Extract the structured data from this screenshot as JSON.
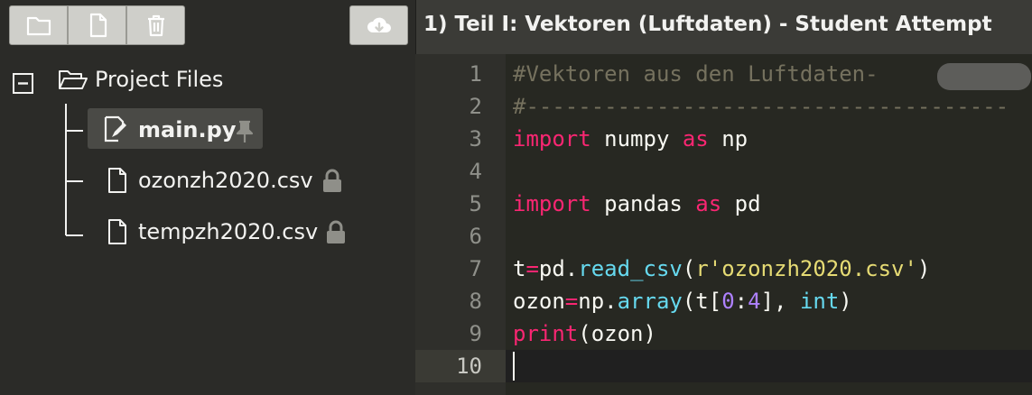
{
  "toolbar": {
    "new_folder_icon": "folder-icon",
    "new_file_icon": "file-icon",
    "delete_icon": "trash-icon",
    "download_icon": "cloud-download-icon"
  },
  "tree": {
    "root_label": "Project Files",
    "files": [
      {
        "name": "main.py",
        "badge": "pin-icon"
      },
      {
        "name": "ozonzh2020.csv",
        "badge": "lock-icon"
      },
      {
        "name": "tempzh2020.csv",
        "badge": "lock-icon"
      }
    ]
  },
  "editor": {
    "title": "1) Teil I: Vektoren (Luftdaten) - Student Attempt",
    "line_numbers": [
      "1",
      "2",
      "3",
      "4",
      "5",
      "6",
      "7",
      "8",
      "9",
      "10"
    ],
    "lines": {
      "l1": "#Vektoren aus den Luftdaten-",
      "l2": "#-------------------------------------",
      "l3_kw": "import",
      "l3_rest": " numpy ",
      "l3_as": "as",
      "l3_alias": " np",
      "l5_kw": "import",
      "l5_rest": " pandas ",
      "l5_as": "as",
      "l5_alias": " pd",
      "l7_var": "t",
      "l7_eq": "=",
      "l7_mod": "pd.",
      "l7_fn": "read_csv",
      "l7_open": "(",
      "l7_str": "r'ozonzh2020.csv'",
      "l7_close": ")",
      "l8_var": "ozon",
      "l8_eq": "=",
      "l8_mod": "np.",
      "l8_fn": "array",
      "l8_a": "(t[",
      "l8_n0": "0",
      "l8_colon": ":",
      "l8_n4": "4",
      "l8_b": "], ",
      "l8_int": "int",
      "l8_c": ")",
      "l9_fn": "print",
      "l9_rest": "(ozon)"
    }
  },
  "colors": {
    "background": "#272822",
    "keyword": "#f92672",
    "builtin": "#66d9ef",
    "string": "#e6db74",
    "number": "#ae81ff",
    "comment": "#75715e"
  }
}
